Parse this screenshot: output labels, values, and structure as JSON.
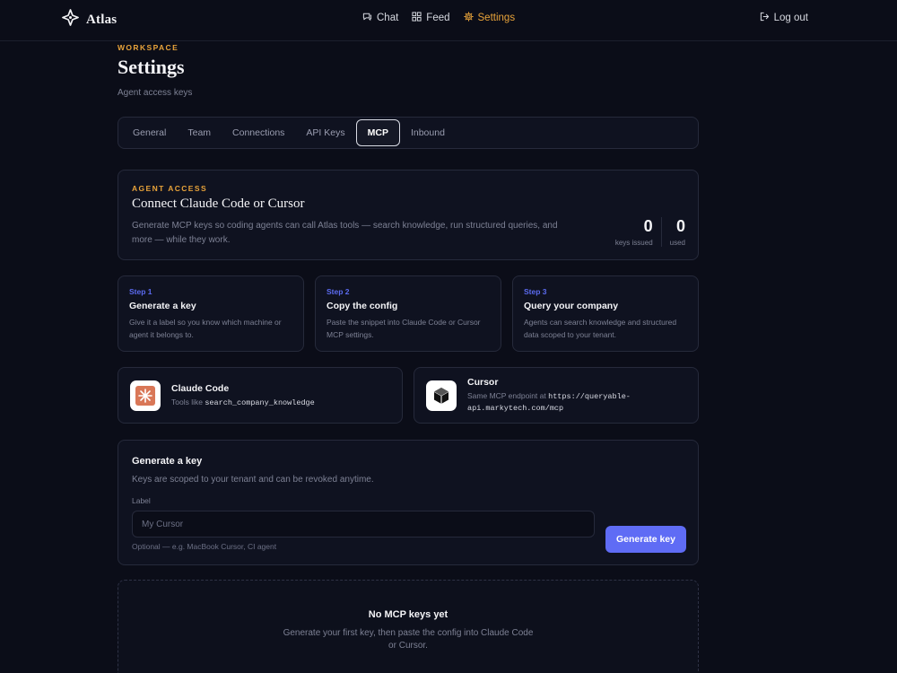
{
  "app": {
    "name": "Atlas"
  },
  "nav": [
    {
      "label": "Chat",
      "icon": "chat-icon"
    },
    {
      "label": "Feed",
      "icon": "feed-grid-icon"
    },
    {
      "label": "Settings",
      "icon": "gear-icon",
      "active": true
    }
  ],
  "logout_label": "Log out",
  "header": {
    "eyebrow": "WORKSPACE",
    "title": "Settings",
    "subtitle": "Agent access keys"
  },
  "tabs": [
    {
      "label": "General"
    },
    {
      "label": "Team"
    },
    {
      "label": "Connections"
    },
    {
      "label": "API Keys"
    },
    {
      "label": "MCP",
      "active": true
    },
    {
      "label": "Inbound"
    }
  ],
  "hero": {
    "eyebrow": "AGENT ACCESS",
    "title": "Connect Claude Code or Cursor",
    "desc": "Generate MCP keys so coding agents can call Atlas tools — search knowledge, run structured queries, and more — while they work.",
    "stats": [
      {
        "value": "0",
        "label": "keys issued"
      },
      {
        "value": "0",
        "label": "used"
      }
    ]
  },
  "steps": [
    {
      "num": "Step 1",
      "title": "Generate a key",
      "desc": "Give it a label so you know which machine or agent it belongs to."
    },
    {
      "num": "Step 2",
      "title": "Copy the config",
      "desc": "Paste the snippet into Claude Code or Cursor MCP settings."
    },
    {
      "num": "Step 3",
      "title": "Query your company",
      "desc": "Agents can search knowledge and structured data scoped to your tenant."
    }
  ],
  "tools": {
    "claude": {
      "name": "Claude Code",
      "desc_prefix": "Tools like ",
      "desc_code": "search_company_knowledge"
    },
    "cursor": {
      "name": "Cursor",
      "desc_prefix": "Same MCP endpoint at ",
      "desc_code": "https://queryable-api.markytech.com/mcp"
    }
  },
  "generate": {
    "title": "Generate a key",
    "desc": "Keys are scoped to your tenant and can be revoked anytime.",
    "label": "Label",
    "placeholder": "My Cursor",
    "value": "",
    "hint": "Optional — e.g. MacBook Cursor, CI agent",
    "button": "Generate key"
  },
  "empty": {
    "title": "No MCP keys yet",
    "desc": "Generate your first key, then paste the config into Claude Code or Cursor."
  },
  "colors": {
    "accent": "#e8a33a",
    "primary": "#5f6cf5",
    "background": "#0b0d18",
    "step": "#5b6bf0"
  }
}
